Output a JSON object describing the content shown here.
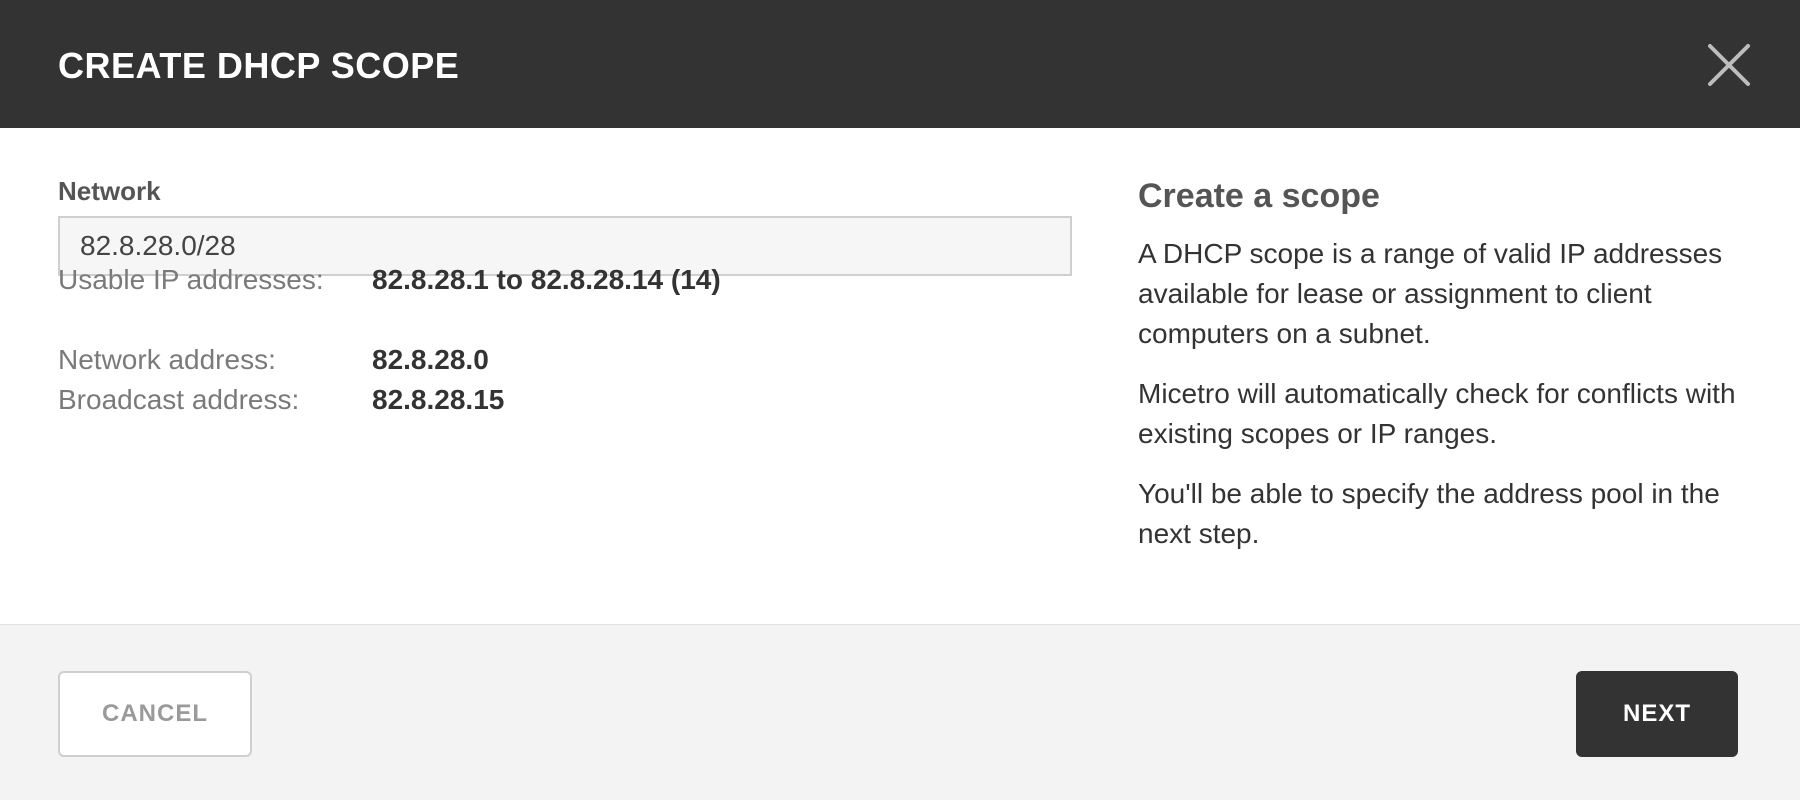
{
  "dialog": {
    "title": "CREATE DHCP SCOPE",
    "close_icon": "close-icon"
  },
  "form": {
    "network_label": "Network",
    "network_value": "82.8.28.0/28",
    "usable_label": "Usable IP addresses:",
    "usable_value": "82.8.28.1 to 82.8.28.14 (14)",
    "network_address_label": "Network address:",
    "network_address_value": "82.8.28.0",
    "broadcast_label": "Broadcast address:",
    "broadcast_value": "82.8.28.15"
  },
  "help": {
    "title": "Create a scope",
    "paragraphs": [
      "A DHCP scope is a range of valid IP addresses available for lease or assignment to client computers on a subnet.",
      "Micetro will automatically check for conflicts with existing scopes or IP ranges.",
      "You'll be able to specify the address pool in the next step."
    ]
  },
  "footer": {
    "cancel_label": "CANCEL",
    "next_label": "NEXT"
  },
  "colors": {
    "header_bg": "#333333",
    "primary_button": "#333333",
    "footer_bg": "#f3f3f3"
  }
}
